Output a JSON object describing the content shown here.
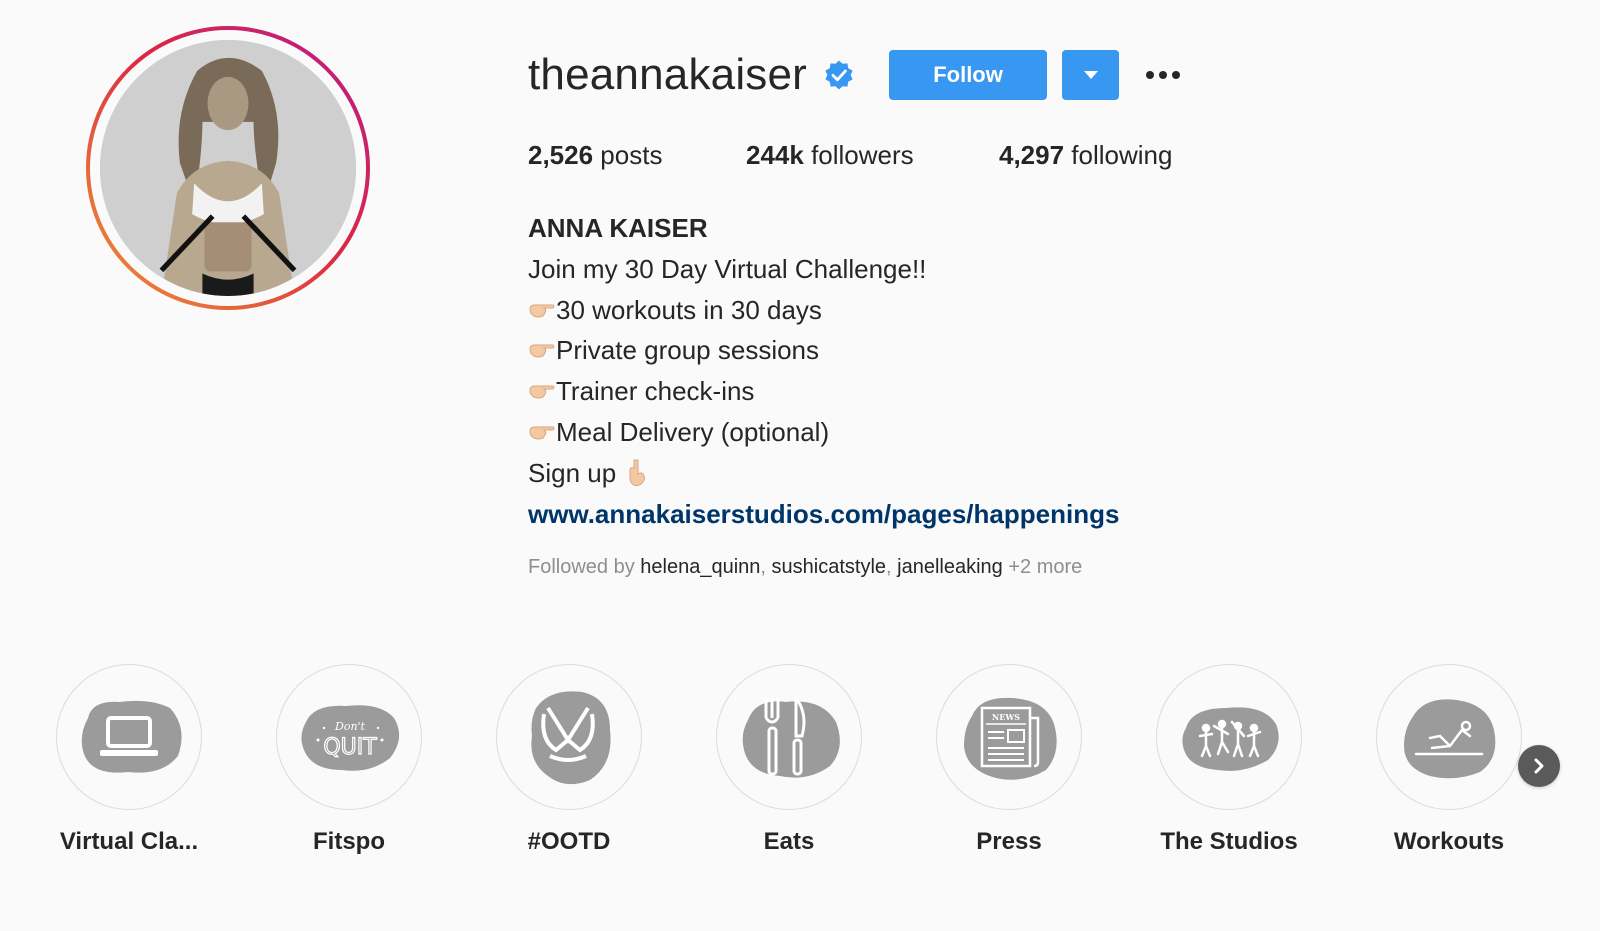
{
  "profile": {
    "username": "theannakaiser",
    "verified": true,
    "follow_label": "Follow",
    "stats": {
      "posts_count": "2,526",
      "posts_label": " posts",
      "followers_count": "244k",
      "followers_label": " followers",
      "following_count": "4,297",
      "following_label": " following"
    },
    "bio": {
      "name": "ANNA KAISER",
      "line1": "Join my 30 Day Virtual Challenge!!",
      "bullets": [
        "30 workouts in 30 days",
        "Private group sessions",
        "Trainer check-ins",
        "Meal Delivery (optional)"
      ],
      "signup": "Sign up",
      "link": "www.annakaiserstudios.com/pages/happenings"
    },
    "followed_by": {
      "prefix": "Followed by ",
      "users": [
        "helena_quinn",
        "sushicatstyle",
        "janelleaking"
      ],
      "suffix": " +2 more"
    }
  },
  "highlights": [
    {
      "label": "Virtual Cla...",
      "icon": "laptop-icon"
    },
    {
      "label": "Fitspo",
      "icon": "dont-quit-icon"
    },
    {
      "label": "#OOTD",
      "icon": "sports-bra-icon"
    },
    {
      "label": "Eats",
      "icon": "fork-knife-icon"
    },
    {
      "label": "Press",
      "icon": "newspaper-icon"
    },
    {
      "label": "The Studios",
      "icon": "dancers-icon"
    },
    {
      "label": "Workouts",
      "icon": "situp-icon"
    }
  ],
  "colors": {
    "accent": "#3897f0",
    "link": "#003569",
    "highlight_blob": "#9b9b9b",
    "muted_text": "#8e8e8e"
  }
}
